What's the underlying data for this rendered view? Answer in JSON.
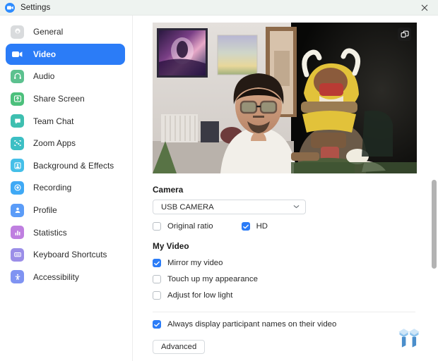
{
  "window": {
    "title": "Settings",
    "app_logo_icon": "zoom-logo-icon",
    "close_label": "✕"
  },
  "colors": {
    "accent": "#2b7cf7",
    "titlebar_bg": "#eef3f0",
    "sidebar_bg": "#ffffff",
    "content_bg": "#ffffff",
    "checkbox_checked": "#2b7cf7",
    "scrollbar_thumb": "#b3b3b3"
  },
  "sidebar": {
    "items": [
      {
        "label": "General",
        "icon": "gear-icon",
        "icon_bg": "#d9dbdd",
        "active": false
      },
      {
        "label": "Video",
        "icon": "video-camera-icon",
        "icon_bg": "#2b7cf7",
        "active": true
      },
      {
        "label": "Audio",
        "icon": "headphones-icon",
        "icon_bg": "#5cc18f",
        "active": false
      },
      {
        "label": "Share Screen",
        "icon": "share-screen-icon",
        "icon_bg": "#4cc07c",
        "active": false
      },
      {
        "label": "Team Chat",
        "icon": "chat-bubble-icon",
        "icon_bg": "#3ebfb0",
        "active": false
      },
      {
        "label": "Zoom Apps",
        "icon": "apps-grid-icon",
        "icon_bg": "#3cbfc4",
        "active": false
      },
      {
        "label": "Background & Effects",
        "icon": "person-frame-icon",
        "icon_bg": "#45bfe8",
        "active": false
      },
      {
        "label": "Recording",
        "icon": "record-circle-icon",
        "icon_bg": "#3fa9f5",
        "active": false
      },
      {
        "label": "Profile",
        "icon": "user-icon",
        "icon_bg": "#5b9cf8",
        "active": false
      },
      {
        "label": "Statistics",
        "icon": "bar-chart-icon",
        "icon_bg": "#bf7fe0",
        "active": false
      },
      {
        "label": "Keyboard Shortcuts",
        "icon": "keyboard-icon",
        "icon_bg": "#9b8ee8",
        "active": false
      },
      {
        "label": "Accessibility",
        "icon": "accessibility-icon",
        "icon_bg": "#7f93f2",
        "active": false
      }
    ]
  },
  "main": {
    "preview": {
      "name": "camera-preview",
      "overlay_button_icon": "pip-swap-icon"
    },
    "camera": {
      "heading": "Camera",
      "selected_device": "USB CAMERA",
      "chevron": "⌄",
      "options": [
        {
          "label": "Original ratio",
          "checked": false
        },
        {
          "label": "HD",
          "checked": true
        }
      ]
    },
    "my_video": {
      "heading": "My Video",
      "options": [
        {
          "label": "Mirror my video",
          "checked": true
        },
        {
          "label": "Touch up my appearance",
          "checked": false
        },
        {
          "label": "Adjust for low light",
          "checked": false
        }
      ]
    },
    "participant": {
      "options": [
        {
          "label": "Always display participant names on their video",
          "checked": true
        }
      ]
    },
    "advanced_label": "Advanced"
  },
  "watermark": {
    "name": "tweaktown-logo"
  }
}
